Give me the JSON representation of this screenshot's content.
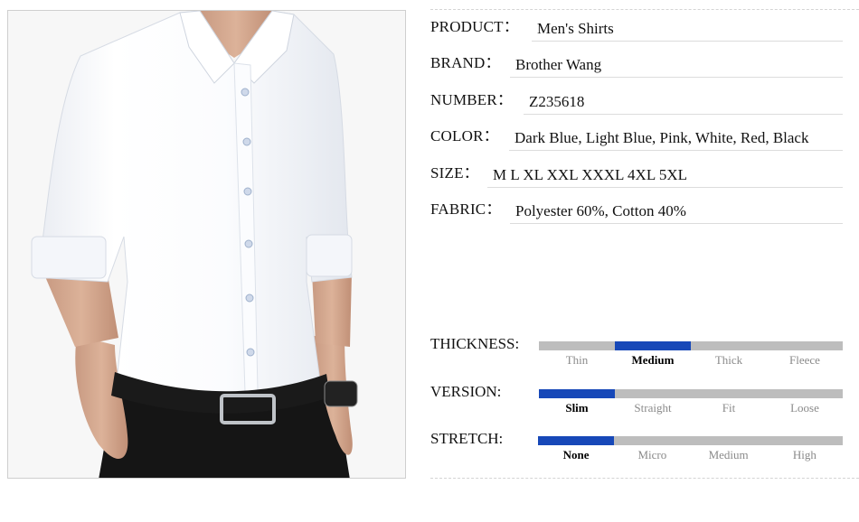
{
  "specs": [
    {
      "label": "PRODUCT：",
      "value": "Men's Shirts"
    },
    {
      "label": "BRAND：",
      "value": "Brother Wang"
    },
    {
      "label": "NUMBER：",
      "value": "Z235618"
    },
    {
      "label": "COLOR：",
      "value": "Dark Blue, Light Blue, Pink, White, Red, Black"
    },
    {
      "label": "SIZE：",
      "value": "M L XL XXL XXXL 4XL 5XL"
    },
    {
      "label": "FABRIC：",
      "value": "Polyester 60%, Cotton 40%"
    }
  ],
  "attributes": [
    {
      "label": "THICKNESS:",
      "options": [
        "Thin",
        "Medium",
        "Thick",
        "Fleece"
      ],
      "selected_index": 1
    },
    {
      "label": "VERSION:",
      "options": [
        "Slim",
        "Straight",
        "Fit",
        "Loose"
      ],
      "selected_index": 0
    },
    {
      "label": "STRETCH:",
      "options": [
        "None",
        "Micro",
        "Medium",
        "High"
      ],
      "selected_index": 0
    }
  ],
  "colors": {
    "bar_active": "#1748b8",
    "bar_inactive": "#bdbdbd",
    "shirt": "#ffffff",
    "trousers": "#151515"
  }
}
